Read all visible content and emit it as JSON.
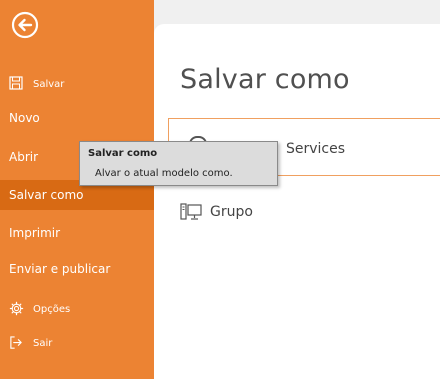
{
  "sidebar": {
    "back_icon": "back-arrow-icon",
    "items": [
      {
        "label": "Salvar",
        "icon": "save-icon"
      },
      {
        "label": "Novo"
      },
      {
        "label": "Abrir"
      },
      {
        "label": "Salvar como"
      },
      {
        "label": "Imprimir"
      },
      {
        "label": "Enviar e publicar"
      },
      {
        "label": "Opções",
        "icon": "gear-icon"
      },
      {
        "label": "Sair",
        "icon": "exit-icon"
      }
    ],
    "selected": "Salvar como"
  },
  "main": {
    "title": "Salvar como",
    "places": [
      {
        "label": "Services",
        "icon": "cloud-icon"
      },
      {
        "label": "Grupo",
        "icon": "network-computer-icon"
      }
    ]
  },
  "tooltip": {
    "title": "Salvar como",
    "description": "Alvar o atual modelo como."
  },
  "colors": {
    "sidebar": "#ec8333",
    "selected": "#d86a14",
    "accent_border": "#f0a060"
  }
}
